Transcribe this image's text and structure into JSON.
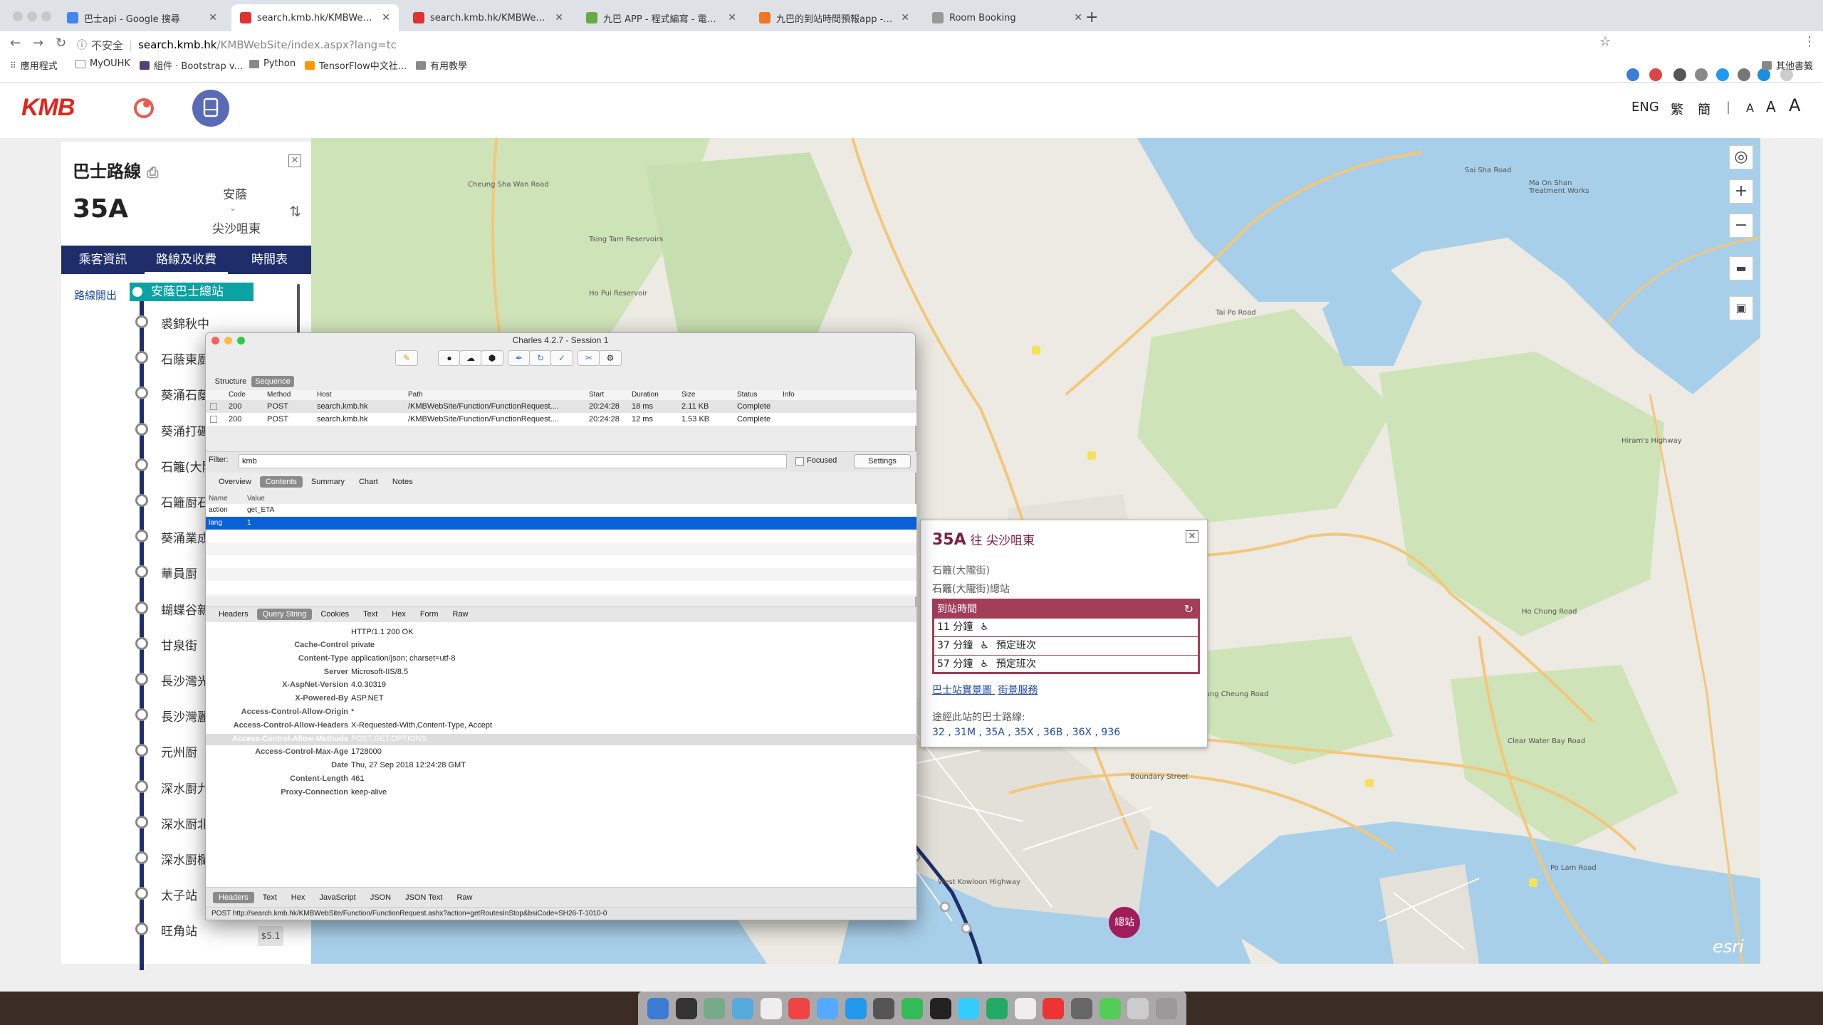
{
  "browser": {
    "tabs": [
      {
        "title": "巴士api - Google 搜尋",
        "color": "#4285f4",
        "active": false
      },
      {
        "title": "search.kmb.hk/KMBWebSite/in",
        "color": "#d33",
        "active": true
      },
      {
        "title": "search.kmb.hk/KMBWebSite/in",
        "color": "#d33",
        "active": false
      },
      {
        "title": "九巴 APP - 程式編寫 - 電腦領域",
        "color": "#6a4",
        "active": false
      },
      {
        "title": "九巴的到站時間預報app - 工作",
        "color": "#e72",
        "active": false
      },
      {
        "title": "Room Booking",
        "color": "#999",
        "active": false
      }
    ],
    "url_security": "不安全",
    "url_host": "search.kmb.hk",
    "url_path": "/KMBWebSite/index.aspx?lang=tc",
    "bookmarks": [
      "應用程式",
      "MyOUHK",
      "組件 · Bootstrap v...",
      "Python",
      "TensorFlow中文社...",
      "有用教學"
    ],
    "other_bookmarks": "其他書籤"
  },
  "header": {
    "logo": "KMB",
    "lang_eng": "ENG",
    "lang_trad": "繁",
    "lang_simp": "簡",
    "divider": "|",
    "font_small": "A",
    "font_mid": "A",
    "font_large": "A"
  },
  "sidebar": {
    "title": "巴士路線",
    "close": "✕",
    "route": "35A",
    "from": "安蔭",
    "to": "尖沙咀東",
    "tabs": [
      "乘客資訊",
      "路線及收費",
      "時間表"
    ],
    "depart_label": "路線開出",
    "first_stop": "安蔭巴士總站",
    "stops": [
      "裘錦秋中",
      "石蔭東㕑",
      "葵涌石蔭",
      "葵涌打磡",
      "石籬(大隴",
      "石籬㕑石",
      "葵涌業成",
      "華員㕑",
      "蝴蝶谷新",
      "甘泉街",
      "長沙灣光",
      "長沙灣麗",
      "元州㕑",
      "深水㕑九",
      "深水㕑北",
      "深水㕑欄",
      "太子站",
      "旺角站"
    ],
    "fare": "$5.1"
  },
  "map": {
    "labels": [
      "Tsing Tam Reservoirs",
      "Ho Pui Reservoir",
      "Ma On Shan Treatment Works",
      "Sai Sha Road",
      "Tai Po Road",
      "Cheung Sha Wan Road",
      "Boundary Street",
      "Lung Cheung Road",
      "Clear Water Bay Road",
      "Hiram's Highway",
      "Ho Chung Road",
      "West Kowloon Highway",
      "Po Lam Road"
    ],
    "terminal": "總站",
    "esri": "esri"
  },
  "popup": {
    "route": "35A",
    "direction": "往 尖沙咀東",
    "area": "石籬(大隴街)",
    "stop": "石籬(大隴街)總站",
    "eta_header": "到站時間",
    "etas": [
      {
        "time": "11 分鐘",
        "note": ""
      },
      {
        "time": "37 分鐘",
        "note": "預定班次"
      },
      {
        "time": "57 分鐘",
        "note": "預定班次"
      }
    ],
    "link1": "巴士站實景圖",
    "link2": "街景服務",
    "passing_label": "途經此站的巴士路線:",
    "routes": "32 , 31M , 35A , 35X , 36B , 36X , 936"
  },
  "charles": {
    "title": "Charles 4.2.7 - Session 1",
    "view_tabs": [
      "Structure",
      "Sequence"
    ],
    "columns": [
      "Code",
      "Method",
      "Host",
      "Path",
      "Start",
      "Duration",
      "Size",
      "Status",
      "Info"
    ],
    "rows": [
      {
        "code": "200",
        "method": "POST",
        "host": "search.kmb.hk",
        "path": "/KMBWebSite/Function/FunctionRequest....",
        "start": "20:24:28",
        "duration": "18 ms",
        "size": "2.11 KB",
        "status": "Complete"
      },
      {
        "code": "200",
        "method": "POST",
        "host": "search.kmb.hk",
        "path": "/KMBWebSite/Function/FunctionRequest....",
        "start": "20:24:28",
        "duration": "12 ms",
        "size": "1.53 KB",
        "status": "Complete"
      }
    ],
    "filter_label": "Filter:",
    "filter_value": "kmb",
    "focused": "Focused",
    "settings": "Settings",
    "detail_tabs": [
      "Overview",
      "Contents",
      "Summary",
      "Chart",
      "Notes"
    ],
    "kv_headers": [
      "Name",
      "Value"
    ],
    "kv": [
      {
        "name": "action",
        "value": "get_ETA"
      },
      {
        "name": "lang",
        "value": "1"
      }
    ],
    "req_tabs": [
      "Headers",
      "Query String",
      "Cookies",
      "Text",
      "Hex",
      "Form",
      "Raw"
    ],
    "response_status": "HTTP/1.1 200 OK",
    "response_headers": [
      {
        "k": "Cache-Control",
        "v": "private"
      },
      {
        "k": "Content-Type",
        "v": "application/json; charset=utf-8"
      },
      {
        "k": "Server",
        "v": "Microsoft-IIS/8.5"
      },
      {
        "k": "X-AspNet-Version",
        "v": "4.0.30319"
      },
      {
        "k": "X-Powered-By",
        "v": "ASP.NET"
      },
      {
        "k": "Access-Control-Allow-Origin",
        "v": "*"
      },
      {
        "k": "Access-Control-Allow-Headers",
        "v": "X-Requested-With,Content-Type, Accept"
      },
      {
        "k": "Access-Control-Allow-Methods",
        "v": "POST,GET,OPTIONS"
      },
      {
        "k": "Access-Control-Max-Age",
        "v": "1728000"
      },
      {
        "k": "Date",
        "v": "Thu, 27 Sep 2018 12:24:28 GMT"
      },
      {
        "k": "Content-Length",
        "v": "461"
      },
      {
        "k": "Proxy-Connection",
        "v": "keep-alive"
      }
    ],
    "resp_tabs": [
      "Headers",
      "Text",
      "Hex",
      "JavaScript",
      "JSON",
      "JSON Text",
      "Raw"
    ],
    "status_line": "POST http://search.kmb.hk/KMBWebSite/Function/FunctionRequest.ashx?action=getRoutesInStop&bsiCode=SH26-T-1010-0"
  },
  "dock_colors": [
    "#3a7bd5",
    "#333",
    "#7a8",
    "#5ad",
    "#eee",
    "#e44",
    "#5af",
    "#29e",
    "#555",
    "#3b5",
    "#222",
    "#3cf",
    "#2a6",
    "#eee",
    "#e33",
    "#666",
    "#5c5",
    "#ccc",
    "#999"
  ]
}
